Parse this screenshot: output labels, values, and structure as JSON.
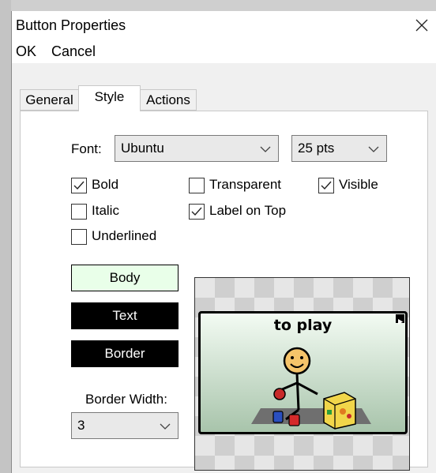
{
  "dialog": {
    "title": "Button Properties"
  },
  "menu": {
    "ok": "OK",
    "cancel": "Cancel"
  },
  "tabs": {
    "general": "General",
    "style": "Style",
    "actions": "Actions",
    "active": "Style"
  },
  "font": {
    "label": "Font:",
    "family": "Ubuntu",
    "size": "25 pts"
  },
  "checkboxes": {
    "bold": {
      "label": "Bold",
      "checked": true
    },
    "italic": {
      "label": "Italic",
      "checked": false
    },
    "underlined": {
      "label": "Underlined",
      "checked": false
    },
    "transparent": {
      "label": "Transparent",
      "checked": false
    },
    "label_on_top": {
      "label": "Label on Top",
      "checked": true
    },
    "visible": {
      "label": "Visible",
      "checked": true
    }
  },
  "colors": {
    "body": {
      "label": "Body",
      "color": "#e9ffe9",
      "text_color": "#000000"
    },
    "text": {
      "label": "Text",
      "color": "#000000",
      "text_color": "#ffffff"
    },
    "border": {
      "label": "Border",
      "color": "#000000",
      "text_color": "#ffffff"
    }
  },
  "border_width": {
    "label": "Border Width:",
    "value": "3"
  },
  "preview": {
    "label": "to play",
    "image": "child-playing-with-toy-blocks-icon"
  }
}
